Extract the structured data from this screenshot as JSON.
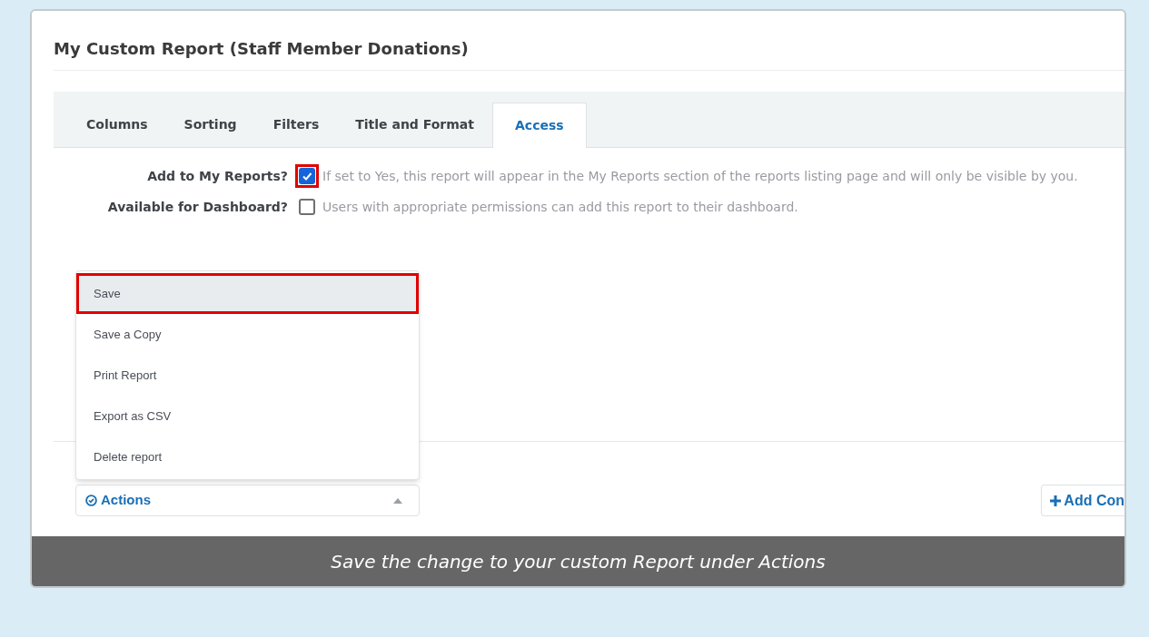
{
  "title": "My Custom Report (Staff Member Donations)",
  "tabs": [
    {
      "label": "Columns",
      "selected": false
    },
    {
      "label": "Sorting",
      "selected": false
    },
    {
      "label": "Filters",
      "selected": false
    },
    {
      "label": "Title and Format",
      "selected": false
    },
    {
      "label": "Access",
      "selected": true
    }
  ],
  "options": [
    {
      "label": "Add to My Reports?",
      "checked": true,
      "highlighted": true,
      "hint": "If set to Yes, this report will appear in the My Reports section of the reports listing page and will only be visible by you."
    },
    {
      "label": "Available for Dashboard?",
      "checked": false,
      "highlighted": false,
      "hint": "Users with appropriate permissions can add this report to their dashboard."
    }
  ],
  "actions_menu": {
    "expanded": true,
    "items": [
      {
        "label": "Save",
        "selected": true,
        "highlighted": true
      },
      {
        "label": "Save a Copy",
        "selected": false,
        "highlighted": false
      },
      {
        "label": "Print Report",
        "selected": false,
        "highlighted": false
      },
      {
        "label": "Export as CSV",
        "selected": false,
        "highlighted": false
      },
      {
        "label": "Delete report",
        "selected": false,
        "highlighted": false
      }
    ],
    "button": "Actions"
  },
  "add_button": "Add Con",
  "caption": "Save the change to your custom Report under Actions"
}
